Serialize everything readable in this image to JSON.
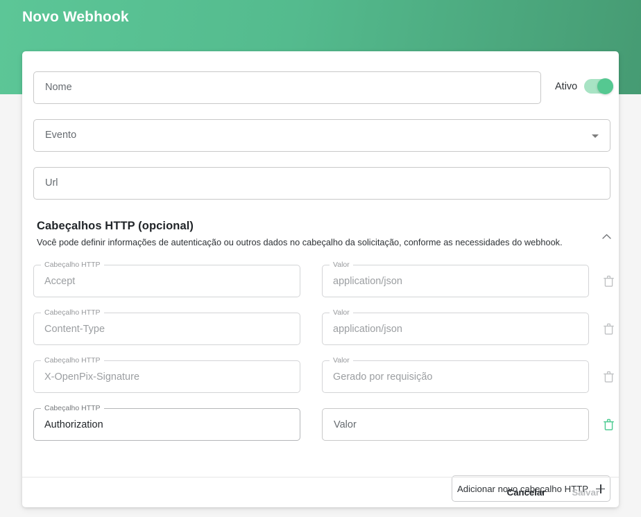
{
  "banner": {
    "title": "Novo Webhook",
    "gradient_from": "#5cc697",
    "gradient_to": "#469b73"
  },
  "form": {
    "nome": {
      "label": "Nome",
      "value": "",
      "placeholder": "Nome"
    },
    "evento": {
      "label": "Evento",
      "value": "",
      "placeholder": "Evento",
      "icon": "dropdown-arrow-icon"
    },
    "url": {
      "label": "Url",
      "value": "",
      "placeholder": "Url"
    },
    "ativo": {
      "label": "Ativo",
      "checked": true,
      "track_color": "#a8e3c4",
      "thumb_color": "#55c891"
    }
  },
  "headers_section": {
    "title": "Cabeçalhos HTTP (opcional)",
    "description": "Você pode definir informações de autenticação ou outros dados no cabeçalho da solicitação, conforme as necessidades do webhook.",
    "collapse_icon": "chevron-up-icon",
    "key_label": "Cabeçalho HTTP",
    "value_label": "Valor",
    "rows": [
      {
        "key": "Accept",
        "value": "application/json",
        "key_label": "Cabeçalho HTTP",
        "value_label": "Valor",
        "editable": false,
        "delete_enabled": false
      },
      {
        "key": "Content-Type",
        "value": "application/json",
        "key_label": "Cabeçalho HTTP",
        "value_label": "Valor",
        "editable": false,
        "delete_enabled": false
      },
      {
        "key": "X-OpenPix-Signature",
        "value": "Gerado por requisição",
        "key_label": "Cabeçalho HTTP",
        "value_label": "Valor",
        "editable": false,
        "delete_enabled": false
      },
      {
        "key": "Authorization",
        "value": "",
        "value_placeholder": "Valor",
        "key_label": "Cabeçalho HTTP",
        "value_label": "Valor",
        "editable": true,
        "delete_enabled": true
      }
    ],
    "add_button": {
      "label": "Adicionar novo cabeçalho HTTP",
      "icon": "plus-icon"
    },
    "delete_icon": "trash-icon",
    "delete_enabled_color": "#4ecb92",
    "delete_disabled_color": "#bfc1c3"
  },
  "footer": {
    "cancel_label": "Cancelar",
    "save_label": "Salvar",
    "save_enabled": false
  }
}
